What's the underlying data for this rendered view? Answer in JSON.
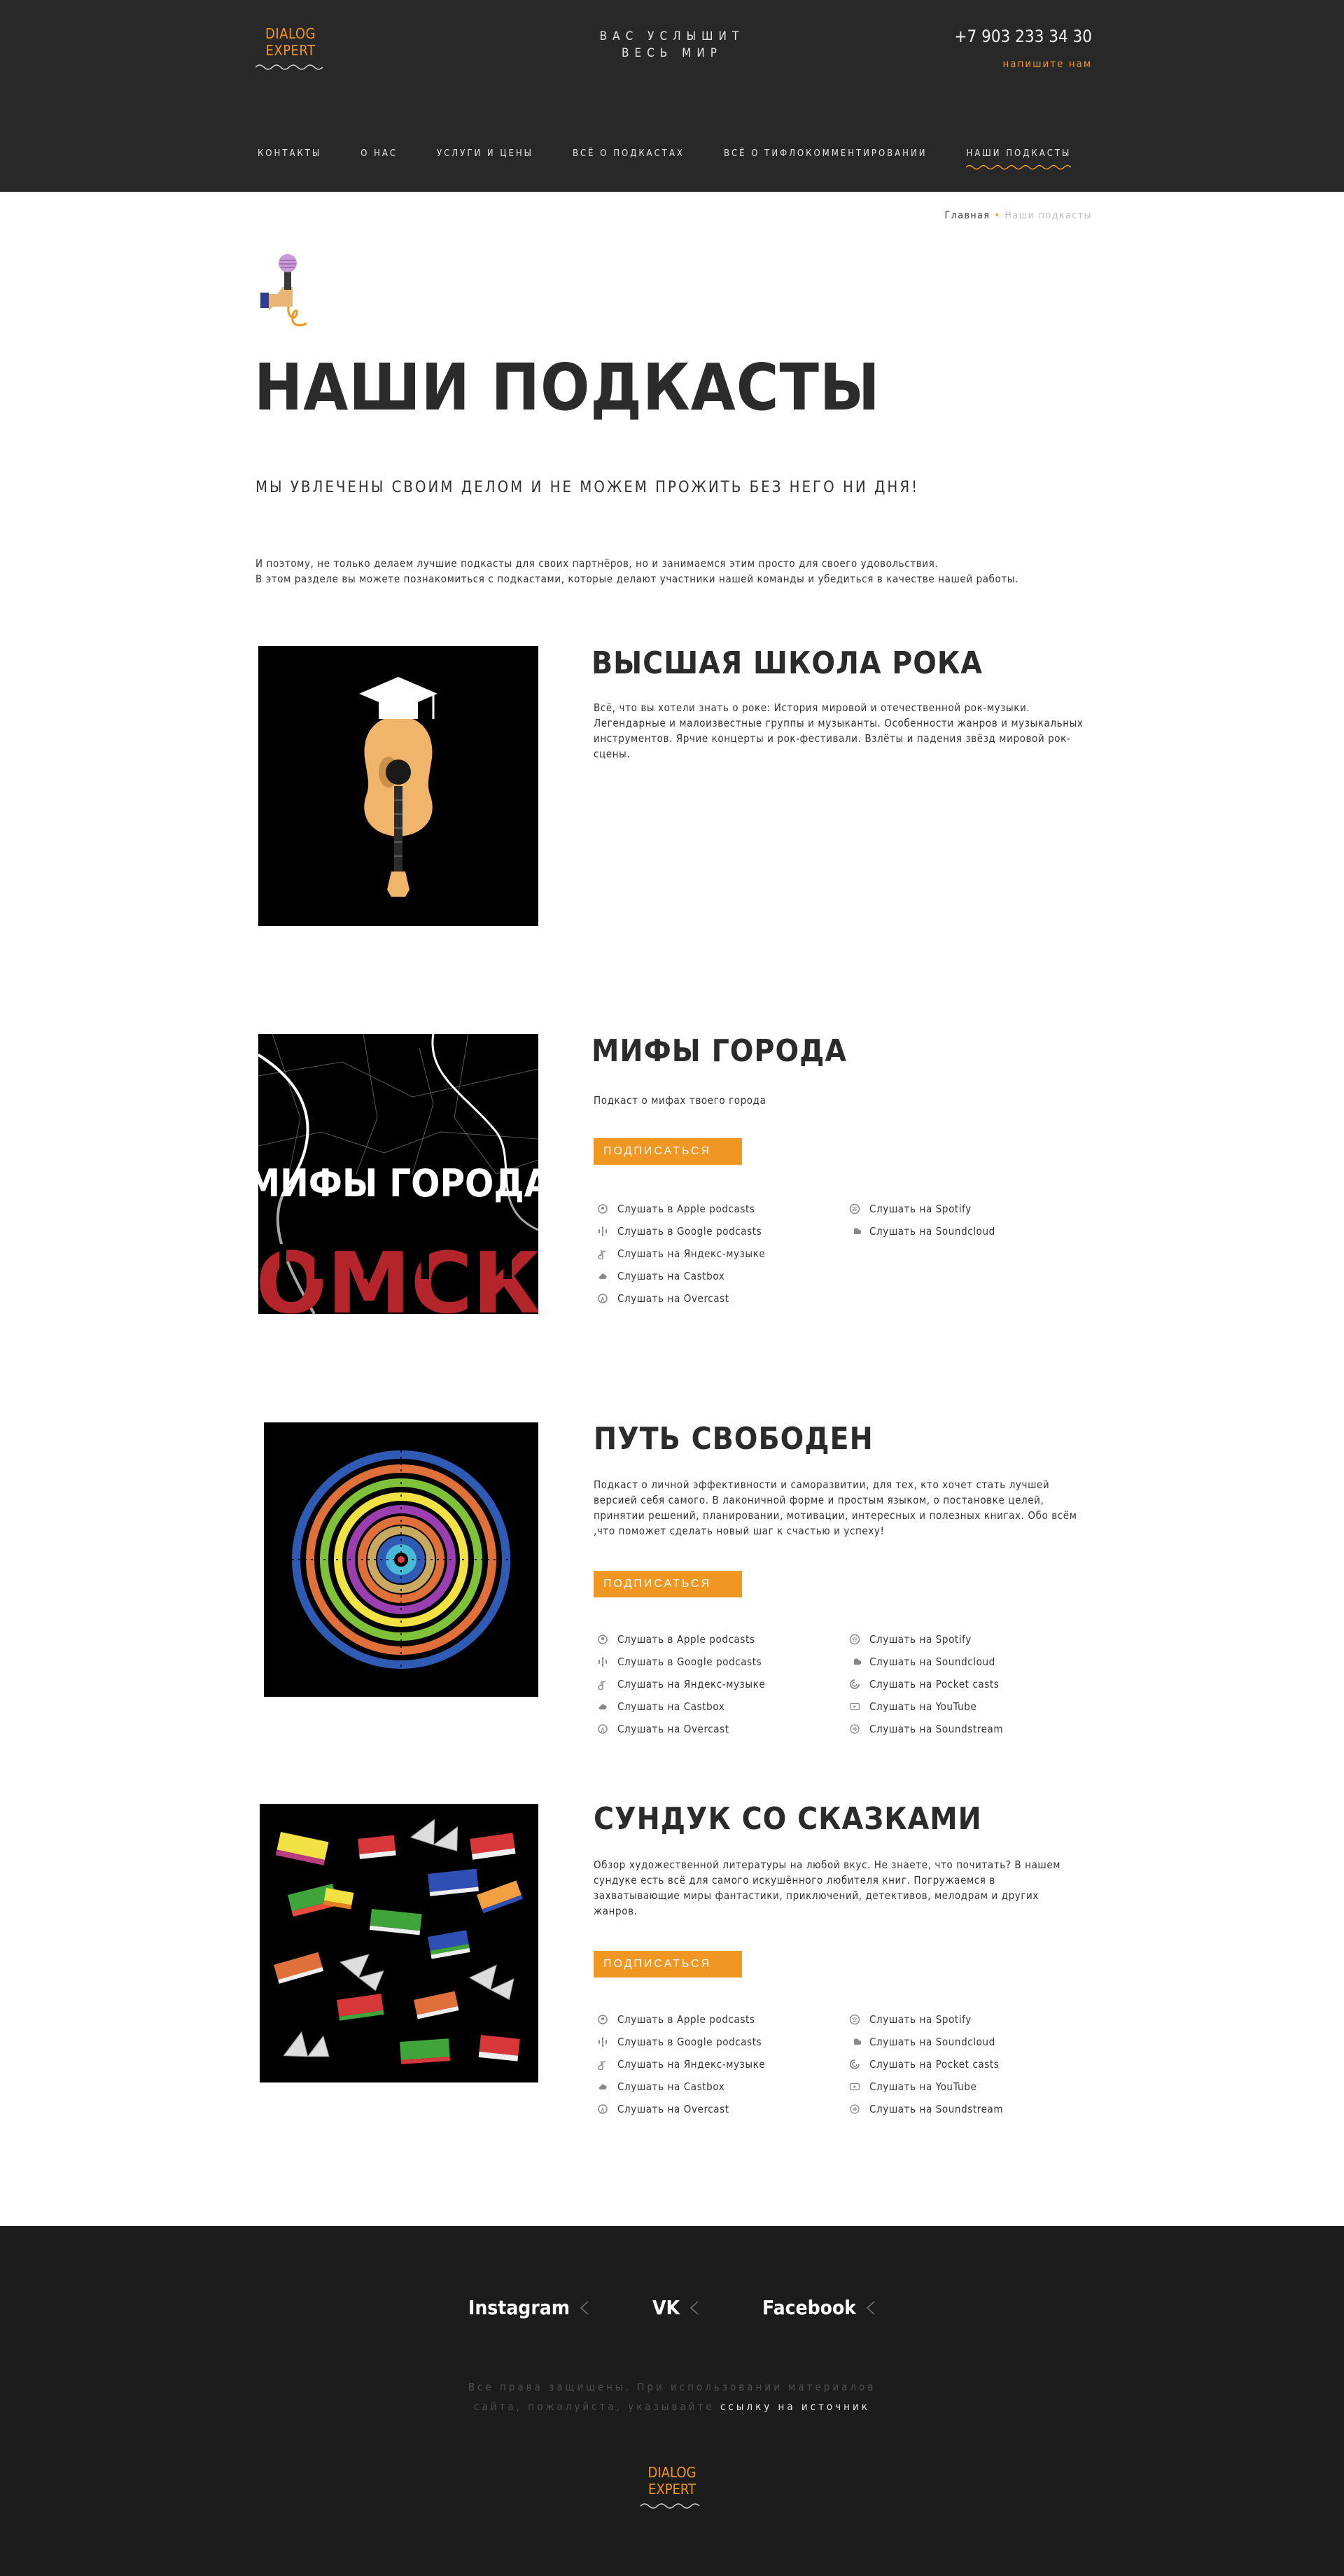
{
  "header": {
    "logo_line1": "DIALOG",
    "logo_line2": "EXPERT",
    "tagline_line1": "ВАС УСЛЫШИТ",
    "tagline_line2": "ВЕСЬ МИР",
    "phone": "+7 903 233 34 30",
    "write_us": "напишите нам",
    "nav": [
      {
        "label": "КОНТАКТЫ"
      },
      {
        "label": "О НАС"
      },
      {
        "label": "УСЛУГИ И ЦЕНЫ"
      },
      {
        "label": "ВСЁ О ПОДКАСТАХ"
      },
      {
        "label": "ВСЁ О ТИФЛОКОММЕНТИРОВАНИИ"
      },
      {
        "label": "НАШИ ПОДКАСТЫ"
      }
    ],
    "accent": "#f09623",
    "bg": "#282828"
  },
  "breadcrumb": {
    "home": "Главная",
    "separator": "•",
    "current": "Наши подкасты"
  },
  "page": {
    "title": "НАШИ ПОДКАСТЫ",
    "slogan": "МЫ УВЛЕЧЕНЫ СВОИМ ДЕЛОМ И НЕ МОЖЕМ ПРОЖИТЬ БЕЗ НЕГО НИ ДНЯ!",
    "intro_line1": "И поэтому, не только делаем лучшие подкасты для своих партнёров, но и занимаемся этим просто для своего удовольствия.",
    "intro_line2": "В этом разделе вы можете познакомиться с подкастами, которые делают участники нашей команды и убедиться в качестве нашей работы."
  },
  "podcasts": [
    {
      "name": "ВЫСШАЯ ШКОЛА РОКА",
      "description": "Всё, что вы хотели знать о роке: История мировой и отечественной рок-музыки. Легендарные и малоизвестные группы и музыканты. Особенности жанров и музыкальных инструментов. Ярчие концерты и рок-фестивали. Взлёты и падения звёзд мировой рок-сцены."
    },
    {
      "name": "МИФЫ ГОРОДА",
      "description": "Подкаст о мифах твоего города",
      "cover_title": "МИФЫ ГОРОДА",
      "cover_city": "ОМСК",
      "subscribe": "ПОДПИСАТЬСЯ",
      "links_left": [
        "Слушать в Apple podcasts",
        "Слушать в Google podcasts",
        "Слушать на Яндекс-музыке",
        "Слушать на Castbox",
        "Слушать на Overcast"
      ],
      "links_right": [
        "Слушать на Spotify",
        "Слушать на Soundcloud"
      ]
    },
    {
      "name": "ПУТЬ СВОБОДЕН",
      "description": "Подкаст о личной эффективности и саморазвитии, для тех, кто хочет стать лучшей версией себя самого. В лаконичной форме и простым языком, о постановке целей, принятии решений, планировании, мотивации, интересных и полезных книгах. Обо всём ,что поможет сделать новый шаг к счастью и успеху!",
      "subscribe": "ПОДПИСАТЬСЯ",
      "links_left": [
        "Слушать в Apple podcasts",
        "Слушать в Google podcasts",
        "Слушать на Яндекс-музыке",
        "Слушать на Castbox",
        "Слушать на Overcast"
      ],
      "links_right": [
        "Слушать на Spotify",
        "Слушать на Soundcloud",
        "Слушать на Pocket casts",
        "Слушать на YouTube",
        "Слушать на Soundstream"
      ]
    },
    {
      "name": "СУНДУК СО СКАЗКАМИ",
      "description": "Обзор художественной литературы на любой вкус. Не знаете, что почитать? В нашем сундуке есть всё для самого искушённого любителя книг. Погружаемся в захватывающие миры фантастики, приключений, детективов, мелодрам и других жанров.",
      "subscribe": "ПОДПИСАТЬСЯ",
      "links_left": [
        "Слушать в Apple podcasts",
        "Слушать в Google podcasts",
        "Слушать на Яндекс-музыке",
        "Слушать на Castbox",
        "Слушать на Overcast"
      ],
      "links_right": [
        "Слушать на Spotify",
        "Слушать на Soundcloud",
        "Слушать на Pocket casts",
        "Слушать на YouTube",
        "Слушать на Soundstream"
      ]
    }
  ],
  "icons_left": [
    "apple-podcasts-icon",
    "google-podcasts-icon",
    "yandex-music-icon",
    "castbox-icon",
    "overcast-icon"
  ],
  "icons_right": [
    "spotify-icon",
    "soundcloud-icon",
    "pocket-casts-icon",
    "youtube-icon",
    "soundstream-icon"
  ],
  "footer": {
    "social": [
      "Instagram",
      "VK",
      "Facebook"
    ],
    "copyright_line1": "Все права защищены. При использовании материалов",
    "copyright_line2": "сайта, пожалуйста, указывайте",
    "copyright_link": "ссылку на источник",
    "logo_line1": "DIALOG",
    "logo_line2": "EXPERT"
  }
}
